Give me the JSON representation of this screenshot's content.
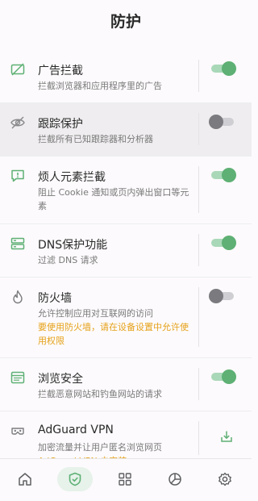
{
  "header": {
    "title": "防护"
  },
  "items": [
    {
      "title": "广告拦截",
      "desc": "拦截浏览器和应用程序里的广告",
      "icon": "ad-block-icon",
      "toggle": true
    },
    {
      "title": "跟踪保护",
      "desc": "拦截所有已知跟踪器和分析器",
      "icon": "eye-off-icon",
      "toggle": false
    },
    {
      "title": "烦人元素拦截",
      "desc": "阻止 Cookie 通知或页内弹出窗口等元素",
      "icon": "annoyance-icon",
      "toggle": true
    },
    {
      "title": "DNS保护功能",
      "desc": "过滤 DNS 请求",
      "icon": "server-icon",
      "toggle": true
    },
    {
      "title": "防火墙",
      "desc": "允许控制应用对互联网的访问",
      "warning": "要使用防火墙，请在设备设置中允许使用权限",
      "icon": "fire-icon",
      "toggle": false
    },
    {
      "title": "浏览安全",
      "desc": "拦截恶意网站和钓鱼网站的请求",
      "icon": "browser-icon",
      "toggle": true
    },
    {
      "title": "AdGuard VPN",
      "desc": "加密流量并让用户匿名浏览网页",
      "warning": "AdGuard VPN 未安装",
      "icon": "vpn-icon",
      "action": "download-icon"
    }
  ],
  "colors": {
    "accent": "#5eb074",
    "warning": "#e6a21a",
    "toggle_off": "#7b7b7f"
  },
  "nav": {
    "tabs": [
      {
        "icon": "home-icon",
        "active": false
      },
      {
        "icon": "shield-check-icon",
        "active": true
      },
      {
        "icon": "apps-icon",
        "active": false
      },
      {
        "icon": "stats-icon",
        "active": false
      },
      {
        "icon": "settings-icon",
        "active": false
      }
    ]
  }
}
